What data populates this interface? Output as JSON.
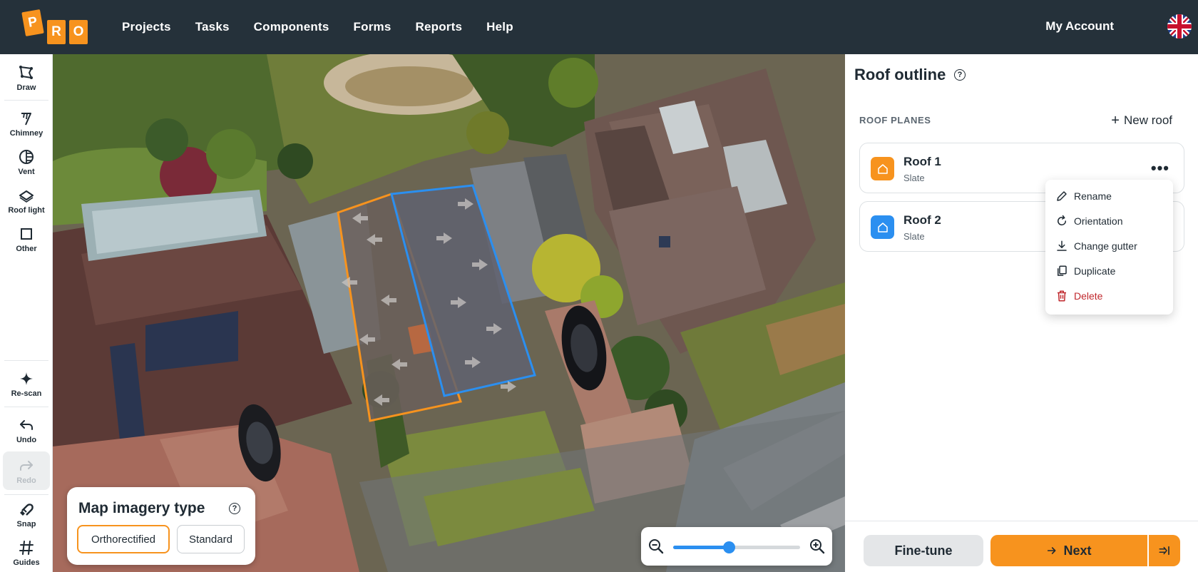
{
  "logo": {
    "letters": [
      "P",
      "R",
      "O"
    ]
  },
  "nav": {
    "items": [
      "Projects",
      "Tasks",
      "Components",
      "Forms",
      "Reports",
      "Help"
    ],
    "account": "My Account",
    "language_flag": "uk-flag-icon"
  },
  "toolbar": {
    "tools": [
      {
        "label": "Draw",
        "icon": "draw-polygon-icon"
      },
      {
        "label": "Chimney",
        "icon": "chimney-icon"
      },
      {
        "label": "Vent",
        "icon": "vent-icon"
      },
      {
        "label": "Roof light",
        "icon": "roof-light-icon"
      },
      {
        "label": "Other",
        "icon": "square-icon"
      },
      {
        "label": "Re-scan",
        "icon": "sparkle-icon"
      },
      {
        "label": "Undo",
        "icon": "undo-icon"
      },
      {
        "label": "Redo",
        "icon": "redo-icon",
        "disabled": true
      },
      {
        "label": "Snap",
        "icon": "magnet-icon"
      },
      {
        "label": "Guides",
        "icon": "hash-icon"
      }
    ]
  },
  "imagery": {
    "title": "Map imagery type",
    "options": [
      "Orthorectified",
      "Standard"
    ],
    "selected": "Orthorectified"
  },
  "zoom": {
    "level": 0.44
  },
  "panel": {
    "title": "Roof outline",
    "section_header": "ROOF PLANES",
    "new_roof": "New roof",
    "roofs": [
      {
        "name": "Roof 1",
        "material": "Slate",
        "color": "#f7931e"
      },
      {
        "name": "Roof 2",
        "material": "Slate",
        "color": "#2b8ff0"
      }
    ],
    "menu": [
      "Rename",
      "Orientation",
      "Change gutter",
      "Duplicate",
      "Delete"
    ],
    "finetune": "Fine-tune",
    "next": "Next"
  },
  "colors": {
    "accent": "#f7931e",
    "blue": "#2b8ff0",
    "danger": "#c0282d",
    "topbar": "#25313a"
  }
}
